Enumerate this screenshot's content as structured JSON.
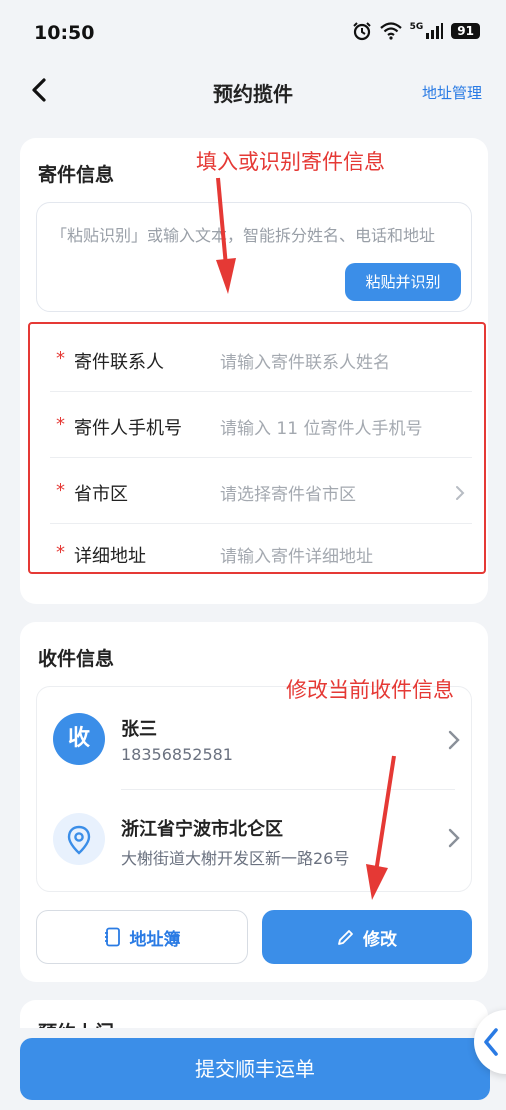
{
  "status": {
    "time": "10:50",
    "battery": "91",
    "network": "5G"
  },
  "nav": {
    "title": "预约揽件",
    "right_link": "地址管理"
  },
  "sender": {
    "title": "寄件信息",
    "paste_placeholder": "「粘贴识别」或输入文本，智能拆分姓名、电话和地址",
    "paste_button": "粘贴并识别",
    "required_mark": "*",
    "fields": [
      {
        "label": "寄件联系人",
        "placeholder": "请输入寄件联系人姓名"
      },
      {
        "label": "寄件人手机号",
        "placeholder": "请输入 11 位寄件人手机号"
      },
      {
        "label": "省市区",
        "placeholder": "请选择寄件省市区"
      },
      {
        "label": "详细地址",
        "placeholder": "请输入寄件详细地址"
      }
    ]
  },
  "receiver": {
    "title": "收件信息",
    "avatar_char": "收",
    "name": "张三",
    "phone": "18356852581",
    "region": "浙江省宁波市北仑区",
    "street": "大榭街道大榭开发区新一路26号",
    "address_book_button": "地址簿",
    "edit_button": "修改"
  },
  "next_section": {
    "title": "预约上门"
  },
  "annotations": {
    "sender_hint": "填入或识别寄件信息",
    "receiver_hint": "修改当前收件信息",
    "color": "#e53935"
  },
  "submit_button": "提交顺丰运单",
  "colors": {
    "accent": "#3b8ee8",
    "link": "#2a7be4",
    "background": "#f2f4f7"
  }
}
